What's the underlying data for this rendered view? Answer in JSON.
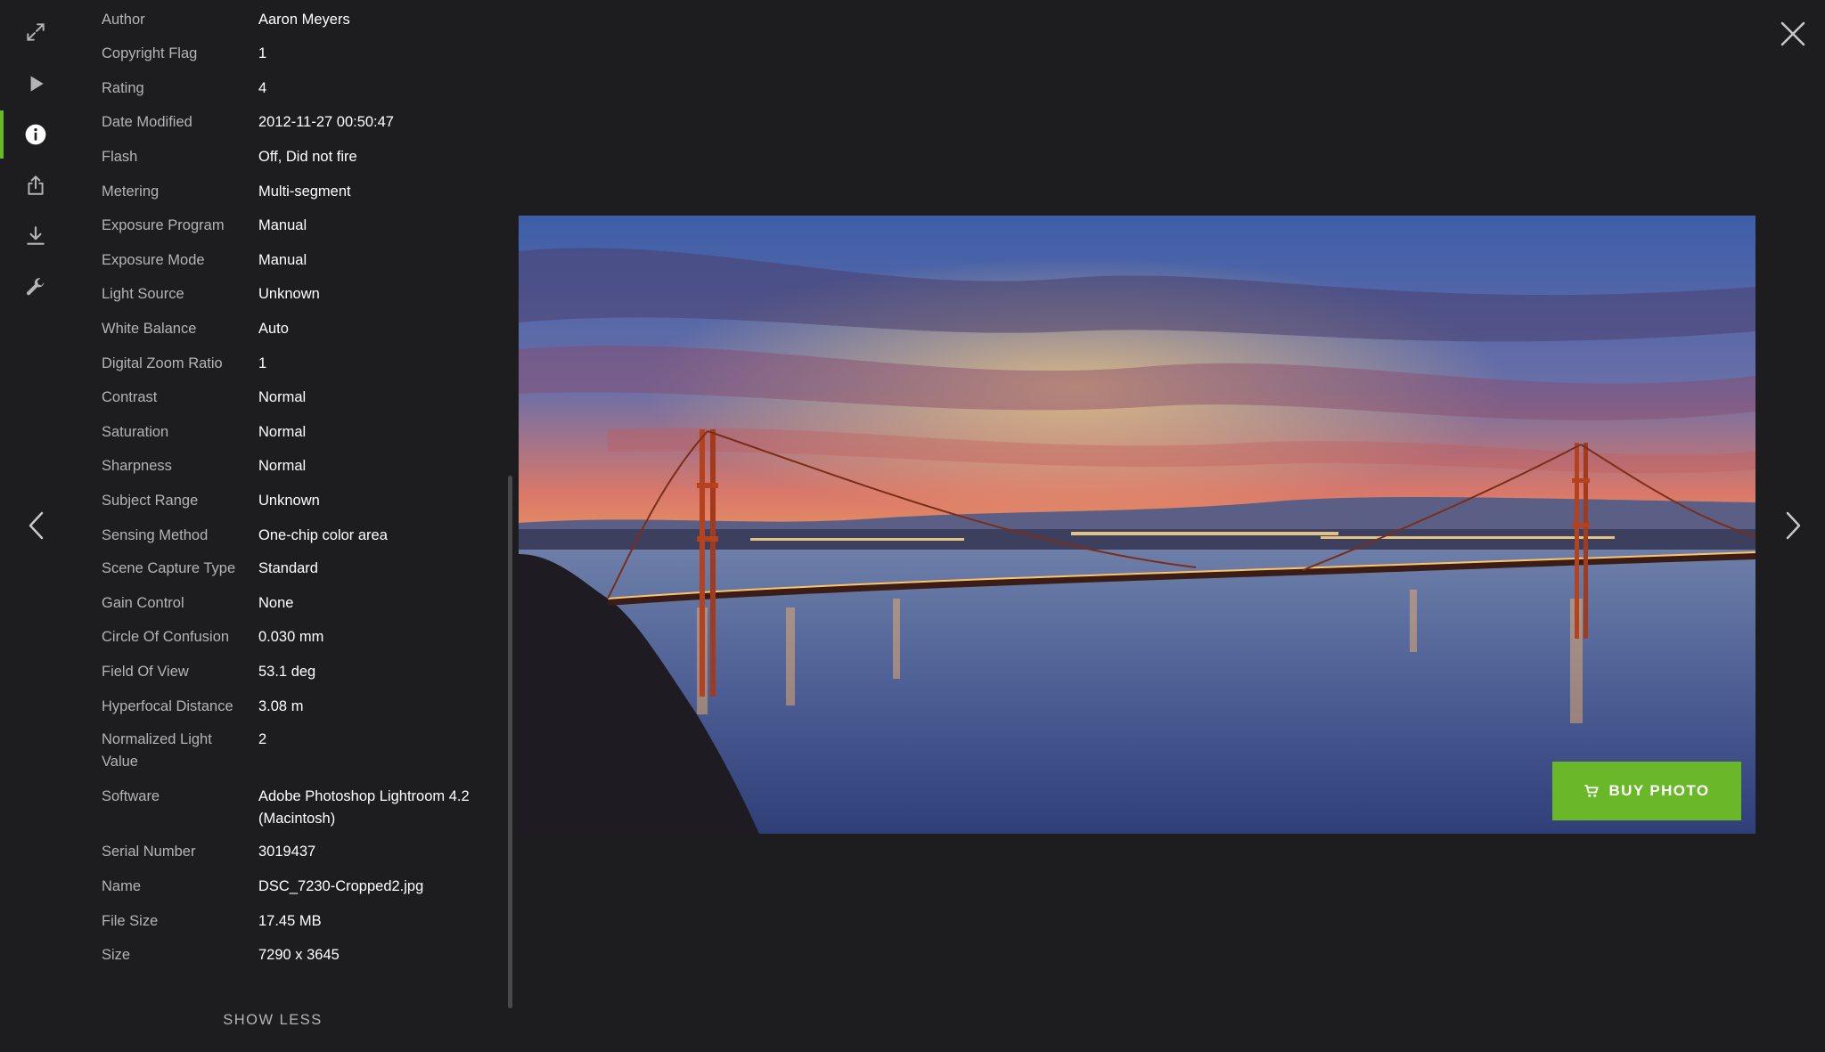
{
  "toolbar": {
    "items": [
      {
        "icon": "fullscreen-icon"
      },
      {
        "icon": "play-icon"
      },
      {
        "icon": "info-icon",
        "active": true
      },
      {
        "icon": "share-icon"
      },
      {
        "icon": "download-icon"
      },
      {
        "icon": "wrench-icon"
      }
    ],
    "accent_color": "#6ab82a"
  },
  "metadata": [
    {
      "label": "Author",
      "value": "Aaron Meyers"
    },
    {
      "label": "Copyright Flag",
      "value": "1"
    },
    {
      "label": "Rating",
      "value": "4"
    },
    {
      "label": "Date Modified",
      "value": "2012-11-27 00:50:47"
    },
    {
      "label": "Flash",
      "value": "Off, Did not fire"
    },
    {
      "label": "Metering",
      "value": "Multi-segment"
    },
    {
      "label": "Exposure Program",
      "value": "Manual"
    },
    {
      "label": "Exposure Mode",
      "value": "Manual"
    },
    {
      "label": "Light Source",
      "value": "Unknown"
    },
    {
      "label": "White Balance",
      "value": "Auto"
    },
    {
      "label": "Digital Zoom Ratio",
      "value": "1"
    },
    {
      "label": "Contrast",
      "value": "Normal"
    },
    {
      "label": "Saturation",
      "value": "Normal"
    },
    {
      "label": "Sharpness",
      "value": "Normal"
    },
    {
      "label": "Subject Range",
      "value": "Unknown"
    },
    {
      "label": "Sensing Method",
      "value": "One-chip color area"
    },
    {
      "label": "Scene Capture Type",
      "value": "Standard"
    },
    {
      "label": "Gain Control",
      "value": "None"
    },
    {
      "label": "Circle Of Confusion",
      "value": "0.030 mm"
    },
    {
      "label": "Field Of View",
      "value": "53.1 deg"
    },
    {
      "label": "Hyperfocal Distance",
      "value": "3.08 m"
    },
    {
      "label": "Normalized Light Value",
      "value": "2"
    },
    {
      "label": "Software",
      "value": "Adobe Photoshop Lightroom 4.2 (Macintosh)"
    },
    {
      "label": "Serial Number",
      "value": "3019437"
    },
    {
      "label": "Name",
      "value": "DSC_7230-Cropped2.jpg"
    },
    {
      "label": "File Size",
      "value": "17.45 MB"
    },
    {
      "label": "Size",
      "value": "7290 x 3645"
    }
  ],
  "show_less_label": "SHOW LESS",
  "buy_button": {
    "label": "BUY PHOTO",
    "icon": "cart-icon",
    "color": "#6ab82a"
  },
  "navigation": {
    "prev_icon": "chevron-left-icon",
    "next_icon": "chevron-right-icon",
    "close_icon": "close-icon"
  }
}
